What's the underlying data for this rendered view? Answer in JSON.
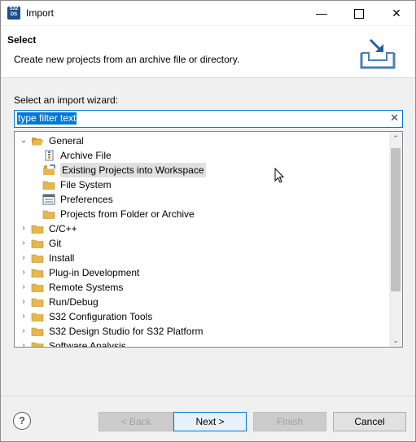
{
  "window": {
    "app_icon_line1": "S32",
    "app_icon_line2": "DS",
    "title": "Import",
    "minimize": "—",
    "close": "✕"
  },
  "header": {
    "title": "Select",
    "description": "Create new projects from an archive file or directory."
  },
  "wizard_label": "Select an import wizard:",
  "filter": {
    "text": "type filter text",
    "clear": "✕"
  },
  "tree": {
    "items": [
      {
        "label": "General",
        "expanded": true,
        "icon": "folder-open-icon"
      },
      {
        "label": "Archive File",
        "icon": "archive-file-icon"
      },
      {
        "label": "Existing Projects into Workspace",
        "icon": "existing-projects-icon",
        "selected": true
      },
      {
        "label": "File System",
        "icon": "folder-icon"
      },
      {
        "label": "Preferences",
        "icon": "preferences-icon"
      },
      {
        "label": "Projects from Folder or Archive",
        "icon": "folder-icon"
      },
      {
        "label": "C/C++",
        "icon": "folder-icon"
      },
      {
        "label": "Git",
        "icon": "folder-icon"
      },
      {
        "label": "Install",
        "icon": "folder-icon"
      },
      {
        "label": "Plug-in Development",
        "icon": "folder-icon"
      },
      {
        "label": "Remote Systems",
        "icon": "folder-icon"
      },
      {
        "label": "Run/Debug",
        "icon": "folder-icon"
      },
      {
        "label": "S32 Configuration Tools",
        "icon": "folder-icon"
      },
      {
        "label": "S32 Design Studio for S32 Platform",
        "icon": "folder-icon"
      },
      {
        "label": "Software Analysis",
        "icon": "folder-icon"
      }
    ],
    "chevron_expanded": "⌄",
    "chevron_collapsed": "›",
    "scroll_up": "⌃",
    "scroll_down": "⌄"
  },
  "buttons": {
    "help": "?",
    "back": "< Back",
    "next": "Next >",
    "finish": "Finish",
    "cancel": "Cancel"
  },
  "colors": {
    "accent": "#0078d7",
    "folder": "#e8b64a"
  }
}
